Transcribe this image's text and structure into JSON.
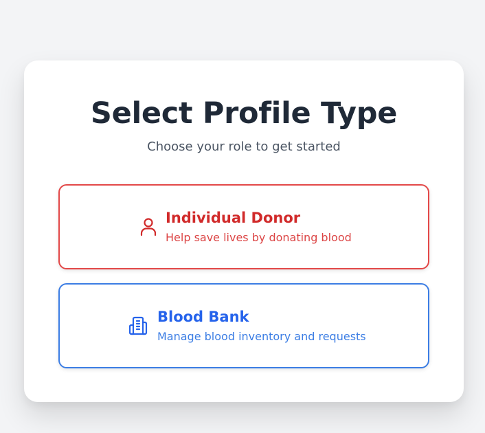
{
  "header": {
    "title": "Select Profile Type",
    "subtitle": "Choose your role to get started"
  },
  "options": [
    {
      "title": "Individual Donor",
      "description": "Help save lives by donating blood",
      "icon": "user-icon",
      "color": "#d12a2a"
    },
    {
      "title": "Blood Bank",
      "description": "Manage blood inventory and requests",
      "icon": "building-icon",
      "color": "#2563eb"
    }
  ]
}
